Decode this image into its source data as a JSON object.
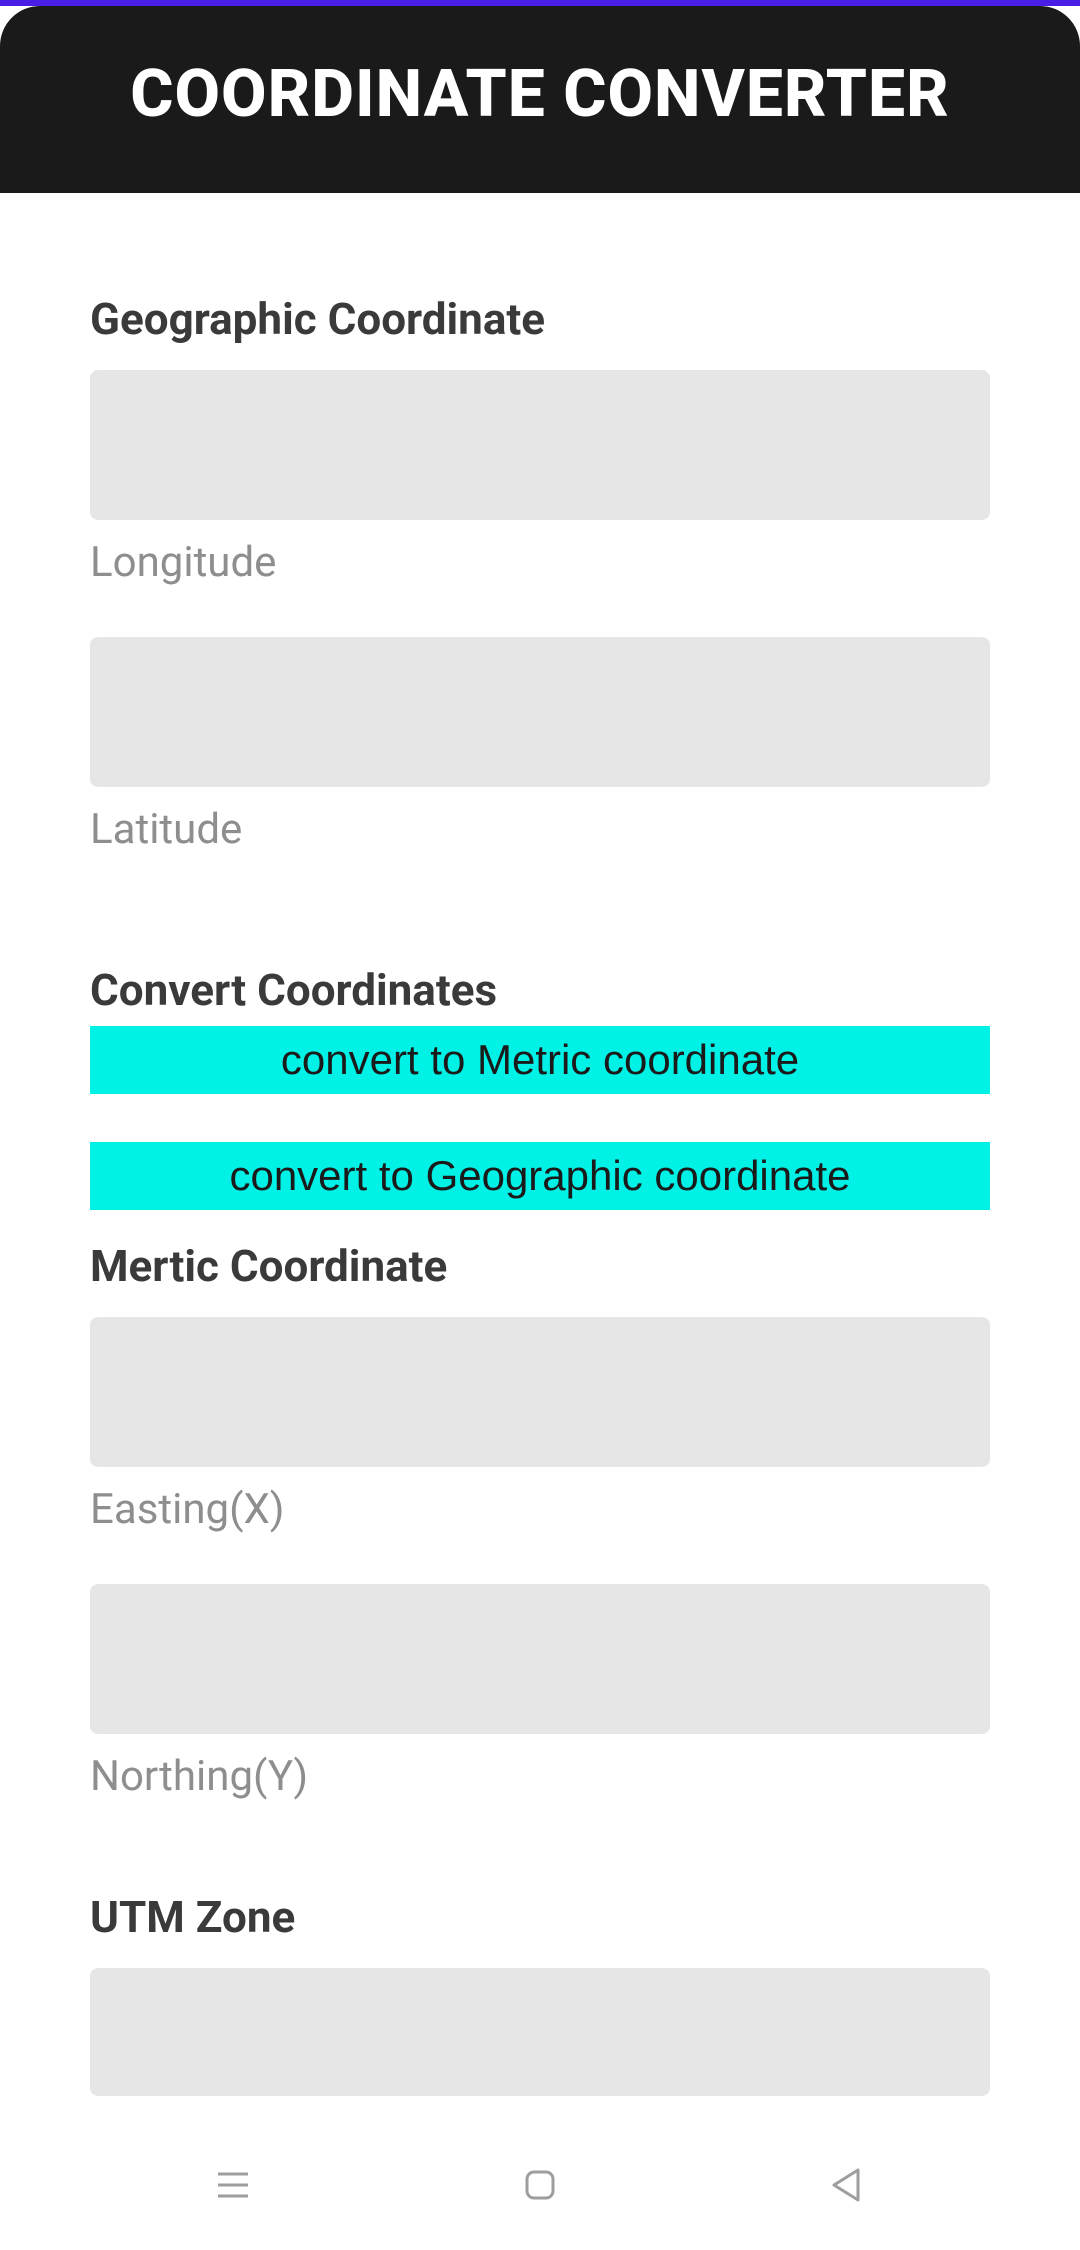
{
  "header": {
    "title": "COORDINATE CONVERTER"
  },
  "sections": {
    "geographic": {
      "title": "Geographic Coordinate",
      "longitude_label": "Longitude",
      "latitude_label": "Latitude"
    },
    "convert": {
      "title": "Convert Coordinates",
      "to_metric_label": "convert to Metric coordinate",
      "to_geographic_label": "convert to Geographic coordinate"
    },
    "metric": {
      "title": "Mertic Coordinate",
      "easting_label": "Easting(X)",
      "northing_label": "Northing(Y)"
    },
    "utm": {
      "title": "UTM Zone"
    }
  }
}
